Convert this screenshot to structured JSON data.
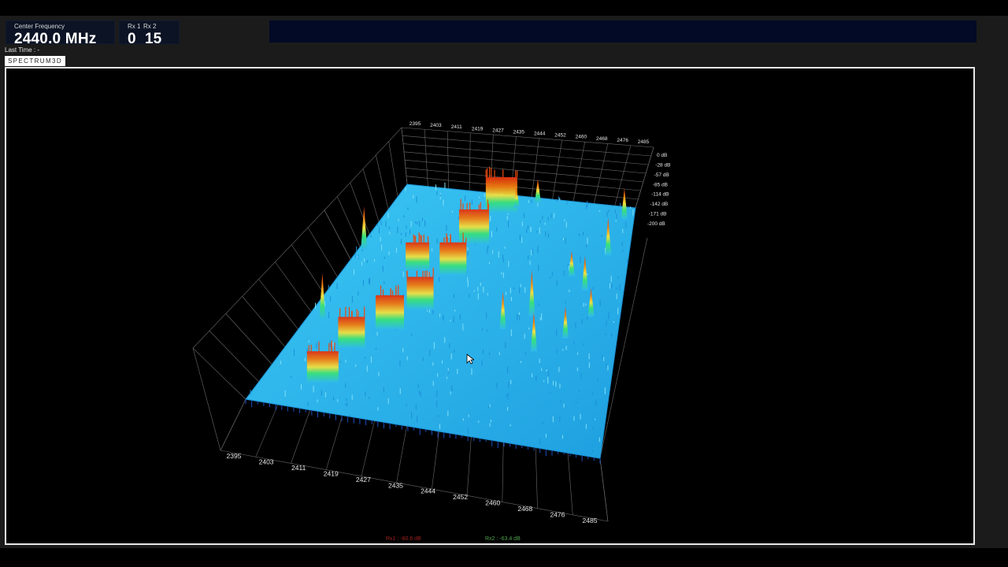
{
  "header": {
    "center_frequency_label": "Center Frequency",
    "center_frequency_value": "2440.0 MHz",
    "rx1_label": "Rx 1",
    "rx2_label": "Rx 2",
    "rx1_value": "0",
    "rx2_value": "15",
    "last_time": "Last Time : -"
  },
  "tabs": [
    {
      "label": "SPECTRUM3D"
    }
  ],
  "readouts": {
    "rx1": "Rx1 : -60.6 dB",
    "rx2": "Rx2 : -63.4 dB"
  },
  "chart_data": {
    "type": "surface3d",
    "freq_ticks_top": [
      "2395",
      "2403",
      "2411",
      "2419",
      "2427",
      "2435",
      "2444",
      "2452",
      "2460",
      "2468",
      "2476",
      "2485"
    ],
    "freq_ticks_bottom": [
      "2395",
      "2403",
      "2411",
      "2419",
      "2427",
      "2435",
      "2444",
      "2452",
      "2460",
      "2468",
      "2476",
      "2485"
    ],
    "db_ticks": [
      "0 dB",
      "-28 dB",
      "-57 dB",
      "-85 dB",
      "-114 dB",
      "-142 dB",
      "-171 dB",
      "-200 dB"
    ],
    "colormap": [
      "#1a9ff0",
      "#3fd0f0",
      "#38e07a",
      "#f0e040",
      "#f07a10",
      "#e03010"
    ],
    "surface_color": "#2fb8f0"
  }
}
